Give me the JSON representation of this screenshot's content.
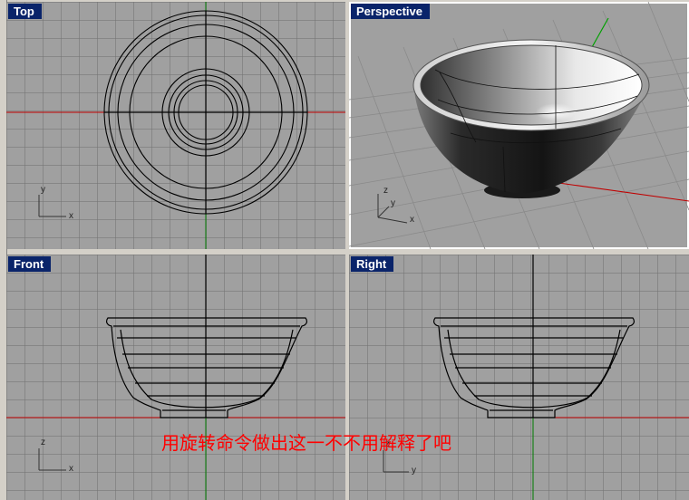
{
  "viewports": {
    "top": {
      "label": "Top",
      "axis_x": "x",
      "axis_y": "y"
    },
    "perspective": {
      "label": "Perspective",
      "axis_x": "x",
      "axis_y": "y",
      "axis_z": "z"
    },
    "front": {
      "label": "Front",
      "axis_x": "x",
      "axis_y": "z"
    },
    "right": {
      "label": "Right",
      "axis_x": "y",
      "axis_y": "z"
    }
  },
  "annotation": "用旋转命令做出这一不不用解释了吧",
  "colors": {
    "viewport_bg": "#a0a0a0",
    "grid_line": "#737373",
    "x_axis": "#c00000",
    "y_axis": "#00a000",
    "label_bg": "#0a246a",
    "annotation": "#ff0000"
  },
  "icons": [
    "axis-triad-icon"
  ]
}
